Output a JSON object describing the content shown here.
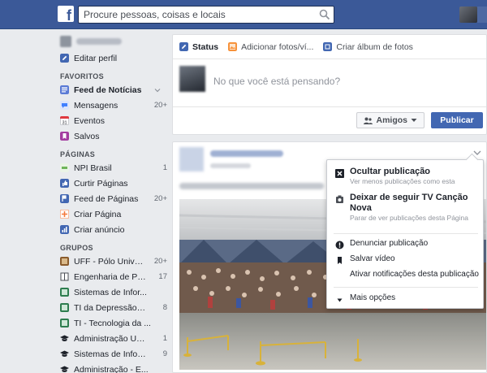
{
  "app": {
    "logo": "f"
  },
  "search": {
    "placeholder": "Procure pessoas, coisas e locais"
  },
  "sidebar": {
    "edit_profile": "Editar perfil",
    "favorites_header": "FAVORITOS",
    "favorites": [
      {
        "label": "Feed de Notícias",
        "count": "",
        "icon": "news-feed-icon",
        "color": "#5b7bd5"
      },
      {
        "label": "Mensagens",
        "count": "20+",
        "icon": "messages-icon",
        "color": "#4080ff"
      },
      {
        "label": "Eventos",
        "count": "",
        "icon": "events-icon",
        "color": "#e9ebee"
      },
      {
        "label": "Salvos",
        "count": "",
        "icon": "saved-icon",
        "color": "#a33ca0"
      }
    ],
    "pages_header": "PÁGINAS",
    "pages": [
      {
        "label": "NPI Brasil",
        "count": "1",
        "icon": "page-icon",
        "color": "#6fb55a"
      },
      {
        "label": "Curtir Páginas",
        "count": "",
        "icon": "like-pages-icon",
        "color": "#4267b2"
      },
      {
        "label": "Feed de Páginas",
        "count": "20+",
        "icon": "pages-feed-icon",
        "color": "#4267b2"
      },
      {
        "label": "Criar Página",
        "count": "",
        "icon": "create-page-icon",
        "color": "#f5793b"
      },
      {
        "label": "Criar anúncio",
        "count": "",
        "icon": "create-ad-icon",
        "color": "#4267b2"
      }
    ],
    "groups_header": "GRUPOS",
    "groups": [
      {
        "label": "UFF - Pólo Univer...",
        "count": "20+",
        "icon": "group-icon",
        "color": "#8a5c2d"
      },
      {
        "label": "Engenharia de Pro...",
        "count": "17",
        "icon": "group-icon",
        "color": "#666"
      },
      {
        "label": "Sistemas de Infor...",
        "count": "",
        "icon": "group-icon",
        "color": "#2e7d4f"
      },
      {
        "label": "TI da Depressão S...",
        "count": "8",
        "icon": "group-icon",
        "color": "#2e7d4f"
      },
      {
        "label": "TI - Tecnologia da ...",
        "count": "",
        "icon": "group-icon",
        "color": "#2e7d4f"
      },
      {
        "label": "Administração UVA...",
        "count": "1",
        "icon": "graduation-cap-icon",
        "color": "#1d2129"
      },
      {
        "label": "Sistemas de Inform...",
        "count": "9",
        "icon": "graduation-cap-icon",
        "color": "#1d2129"
      },
      {
        "label": "Administração - E...",
        "count": "",
        "icon": "graduation-cap-icon",
        "color": "#1d2129"
      }
    ]
  },
  "composer": {
    "tab_status": "Status",
    "tab_photos": "Adicionar fotos/ví...",
    "tab_album": "Criar álbum de fotos",
    "placeholder": "No que você está pensando?",
    "audience": "Amigos",
    "publish": "Publicar"
  },
  "post_menu": {
    "hide_title": "Ocultar publicação",
    "hide_sub": "Ver menos publicações como esta",
    "unfollow_title": "Deixar de seguir TV Canção Nova",
    "unfollow_sub": "Parar de ver publicações desta Página",
    "report": "Denunciar publicação",
    "save_video": "Salvar vídeo",
    "notifications": "Ativar notificações desta publicação",
    "more": "Mais opções"
  },
  "colors": {
    "brand": "#3b5998",
    "button": "#4267b2"
  }
}
